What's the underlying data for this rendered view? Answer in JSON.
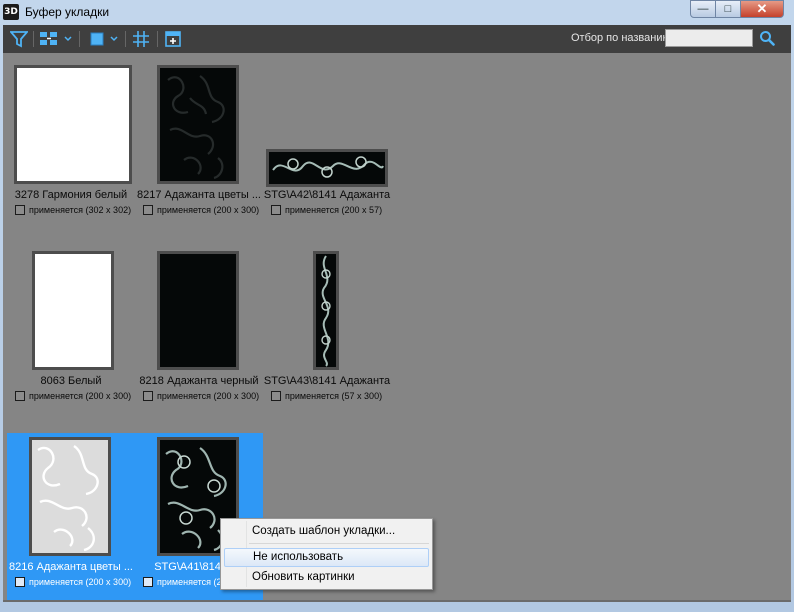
{
  "window": {
    "app_icon": "3D",
    "title": "Буфер укладки",
    "minimize": "—",
    "maximize": "□",
    "close": "✕"
  },
  "toolbar": {
    "icons": [
      "filter-icon",
      "sort-icon",
      "view-mode-icon",
      "grid-icon",
      "import-icon",
      "search-icon"
    ],
    "filter_label": "Отбор по названию",
    "filter_value": ""
  },
  "tiles": [
    {
      "name": "3278 Гармония белый",
      "status": "применяется (302 x 302)",
      "swatch": "white",
      "selected": false
    },
    {
      "name": "8217 Адажанта цветы ...",
      "status": "применяется (200 x 300)",
      "swatch": "black-pattern",
      "selected": false
    },
    {
      "name": "STG\\A42\\8141 Адажанта",
      "status": "применяется (200 x 57)",
      "swatch": "black-floral",
      "selected": false
    },
    {
      "name": "8063 Белый",
      "status": "применяется (200 x 300)",
      "swatch": "white",
      "selected": false
    },
    {
      "name": "8218 Адажанта черный",
      "status": "применяется (200 x 300)",
      "swatch": "black",
      "selected": false
    },
    {
      "name": "STG\\A43\\8141 Адажанта",
      "status": "применяется (57 x 300)",
      "swatch": "black-floral",
      "selected": false
    },
    {
      "name": "8216 Адажанта цветы ...",
      "status": "применяется (200 x 300)",
      "swatch": "white-lace",
      "selected": true
    },
    {
      "name": "STG\\A41\\8141 Ад",
      "status": "применяется (20",
      "swatch": "black-floral",
      "selected": true
    }
  ],
  "context_menu": {
    "items": [
      "Создать шаблон укладки...",
      "Не использовать",
      "Обновить картинки"
    ],
    "highlighted": "Не использовать"
  },
  "colors": {
    "content_bg": "#858585",
    "toolbar_bg": "#3f3f3f",
    "selection": "#2f98f5",
    "toolbar_icon": "#4fb3f5"
  }
}
